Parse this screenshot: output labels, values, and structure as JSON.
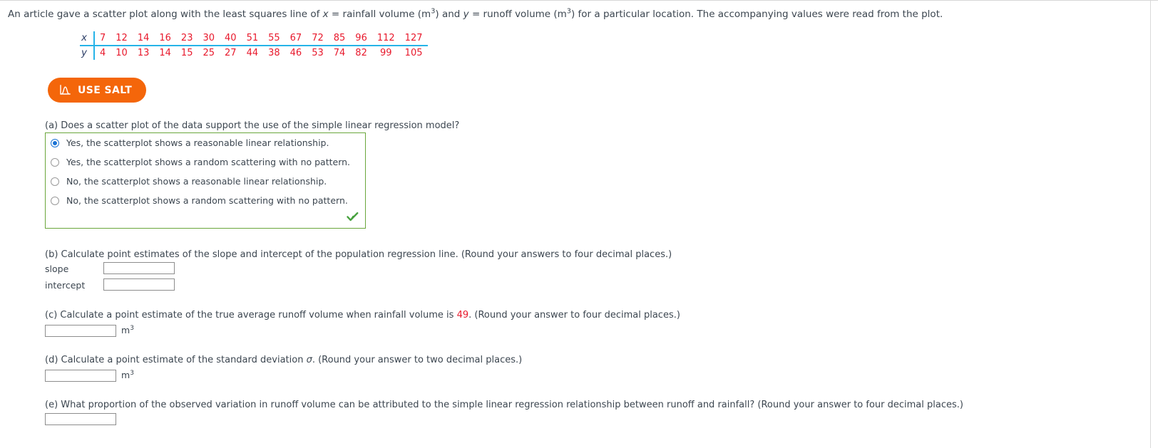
{
  "problem": {
    "intro_part1": "An article gave a scatter plot along with the least squares line of ",
    "intro_var_x": "x",
    "intro_part2": " = rainfall volume (m",
    "intro_exp1": "3",
    "intro_part3": ") and ",
    "intro_var_y": "y",
    "intro_part4": " = runoff volume (m",
    "intro_exp2": "3",
    "intro_part5": ") for a particular location. The accompanying values were read from the plot."
  },
  "data_table": {
    "x_label": "x",
    "y_label": "y",
    "x_values": [
      7,
      12,
      14,
      16,
      23,
      30,
      40,
      51,
      55,
      67,
      72,
      85,
      96,
      112,
      127
    ],
    "y_values": [
      4,
      10,
      13,
      14,
      15,
      25,
      27,
      44,
      38,
      46,
      53,
      74,
      82,
      99,
      105
    ]
  },
  "salt_button": {
    "label": "USE SALT",
    "icon": "normal-curve-icon",
    "background_color": "#f4660a",
    "text_color": "#ffffff"
  },
  "part_a": {
    "question": "(a) Does a scatter plot of the data support the use of the simple linear regression model?",
    "options": [
      {
        "label": "Yes, the scatterplot shows a reasonable linear relationship.",
        "selected": true
      },
      {
        "label": "Yes, the scatterplot shows a random scattering with no pattern.",
        "selected": false
      },
      {
        "label": "No, the scatterplot shows a reasonable linear relationship.",
        "selected": false
      },
      {
        "label": "No, the scatterplot shows a random scattering with no pattern.",
        "selected": false
      }
    ],
    "status_icon": "green-check-icon",
    "border_color": "#6aa63b",
    "selected_color": "#1b73d4"
  },
  "part_b": {
    "question": "(b) Calculate point estimates of the slope and intercept of the population regression line. (Round your answers to four decimal places.)",
    "slope_label": "slope",
    "slope_value": "",
    "intercept_label": "intercept",
    "intercept_value": ""
  },
  "part_c": {
    "question_pre": "(c) Calculate a point estimate of the true average runoff volume when rainfall volume is ",
    "question_highlight": "49",
    "question_post": ". (Round your answer to four decimal places.)",
    "highlight_color": "#e8192c",
    "value": "",
    "unit": "m",
    "unit_exponent": "3"
  },
  "part_d": {
    "question_pre": "(d) Calculate a point estimate of the standard deviation ",
    "question_symbol": "σ",
    "question_post": ". (Round your answer to two decimal places.)",
    "value": "",
    "unit": "m",
    "unit_exponent": "3"
  },
  "part_e": {
    "question": "(e) What proportion of the observed variation in runoff volume can be attributed to the simple linear regression relationship between runoff and rainfall? (Round your answer to four decimal places.)",
    "value": ""
  }
}
